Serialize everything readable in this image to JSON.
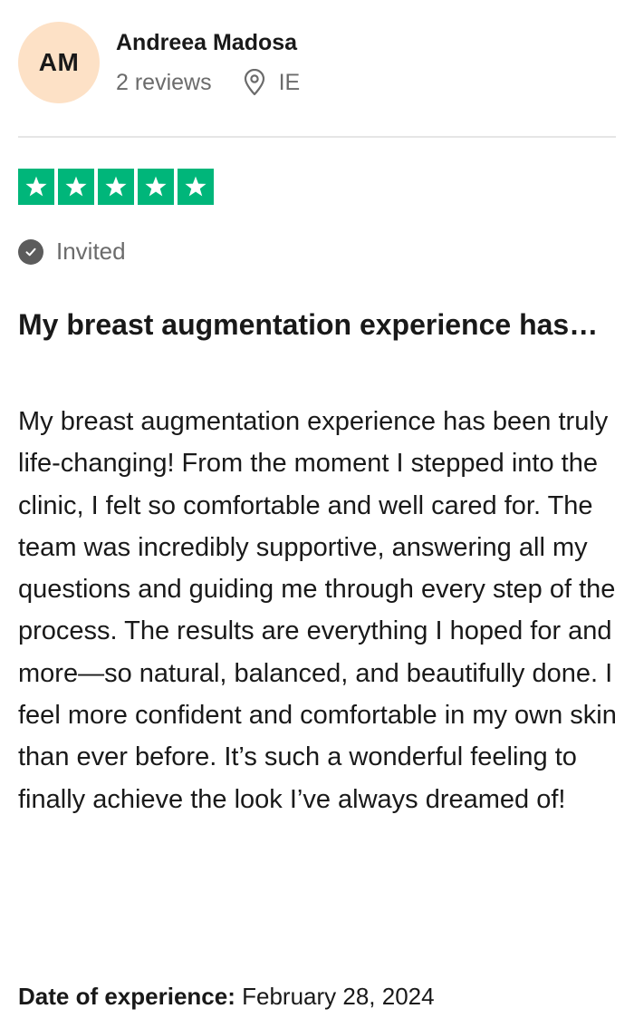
{
  "reviewer": {
    "initials": "AM",
    "name": "Andreea Madosa",
    "reviews": "2 reviews",
    "country": "IE"
  },
  "rating": {
    "stars": 5,
    "max": 5,
    "color": "#00b67a",
    "icon": "star-icon"
  },
  "badge": {
    "label": "Invited",
    "icon": "check-circle-icon"
  },
  "review": {
    "title": "My breast augmentation experience has…",
    "body": "My breast augmentation experience has been truly life-changing! From the moment I stepped into the clinic, I felt so comfortable and well cared for. The team was incredibly supportive, answering all my questions and guiding me through every step of the process. The results are everything I hoped for and more—so natural, balanced, and beautifully done. I feel more confident and comfortable in my own skin than ever before. It’s such a wonderful feeling to finally achieve the look I’ve always dreamed of!"
  },
  "experience": {
    "label": "Date of experience:",
    "date": "February 28, 2024"
  },
  "colors": {
    "avatar_bg": "#fde1c6",
    "star_green": "#00b67a",
    "muted_text": "#6b6b6b",
    "divider": "#e5e5e5"
  }
}
